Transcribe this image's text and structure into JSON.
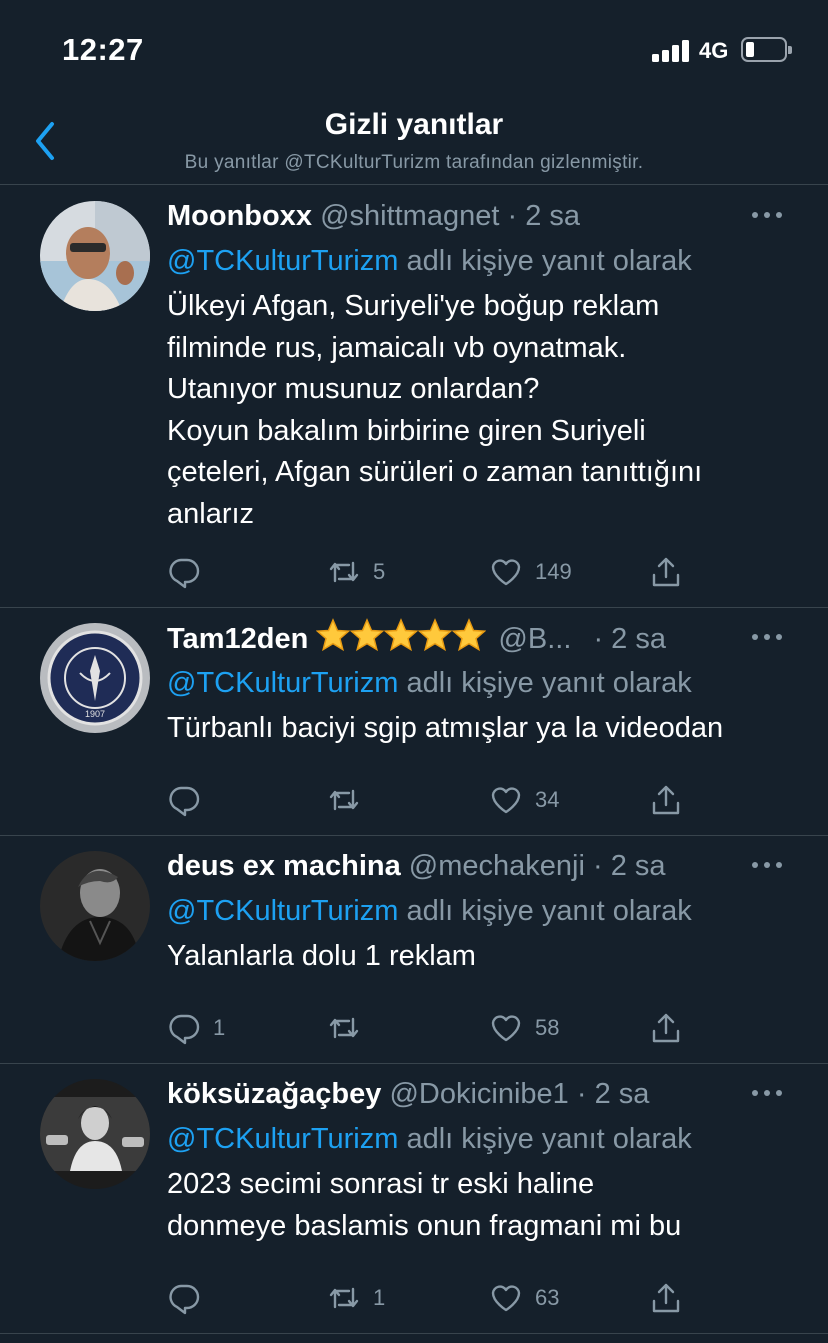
{
  "status_bar": {
    "time": "12:27",
    "network": "4G"
  },
  "header": {
    "title": "Gizli yanıtlar",
    "subtitle": "Bu yanıtlar @TCKulturTurizm tarafından gizlenmiştir."
  },
  "tweets": [
    {
      "name": "Moonboxx",
      "handle": "@shittmagnet",
      "dot": "·",
      "time": "2 sa",
      "mention": "@TCKulturTurizm",
      "reply_label": "adlı kişiye yanıt olarak",
      "text_lines": [
        "Ülkeyi Afgan, Suriyeli'ye boğup reklam",
        "filminde rus, jamaicalı vb oynatmak.",
        "Utanıyor musunuz onlardan?",
        "Koyun bakalım birbirine giren Suriyeli",
        "çeteleri, Afgan sürüleri o zaman tanıttığını",
        "anlarız"
      ],
      "replies": "",
      "retweets": "5",
      "likes": "149"
    },
    {
      "name": "Tam12den",
      "handle": "@B...",
      "dot": "·",
      "time": "2 sa",
      "mention": "@TCKulturTurizm",
      "reply_label": "adlı kişiye yanıt olarak",
      "text_lines": [
        "Türbanlı baciyi sgip atmışlar ya la videodan"
      ],
      "replies": "",
      "retweets": "",
      "likes": "34"
    },
    {
      "name": "deus ex machina",
      "handle": "@mechakenji",
      "dot": "·",
      "time": "2 sa",
      "mention": "@TCKulturTurizm",
      "reply_label": "adlı kişiye yanıt olarak",
      "text_lines": [
        "Yalanlarla dolu 1 reklam"
      ],
      "replies": "1",
      "retweets": "",
      "likes": "58"
    },
    {
      "name": "köksüzağaçbey",
      "handle": "@Dokicinibe1",
      "dot": "·",
      "time": "2 sa",
      "mention": "@TCKulturTurizm",
      "reply_label": "adlı kişiye yanıt olarak",
      "text_lines": [
        "2023 secimi sonrasi tr eski haline",
        "donmeye baslamis onun fragmani mi bu"
      ],
      "replies": "",
      "retweets": "1",
      "likes": "63"
    }
  ],
  "icons": {
    "back": "chevron-left-icon",
    "more": "more-horizontal-icon",
    "reply": "reply-icon",
    "retweet": "retweet-icon",
    "like": "heart-icon",
    "share": "share-icon",
    "star": "star-icon"
  },
  "colors": {
    "background": "#15202b",
    "accent": "#1da1f2",
    "secondary_text": "#8899a6",
    "divider": "#38444d"
  },
  "tweet2_stars": 5,
  "tweet2_emblem_text": "FENERBAHÇE SPOR KULÜBÜ",
  "tweet2_emblem_year": "1907"
}
